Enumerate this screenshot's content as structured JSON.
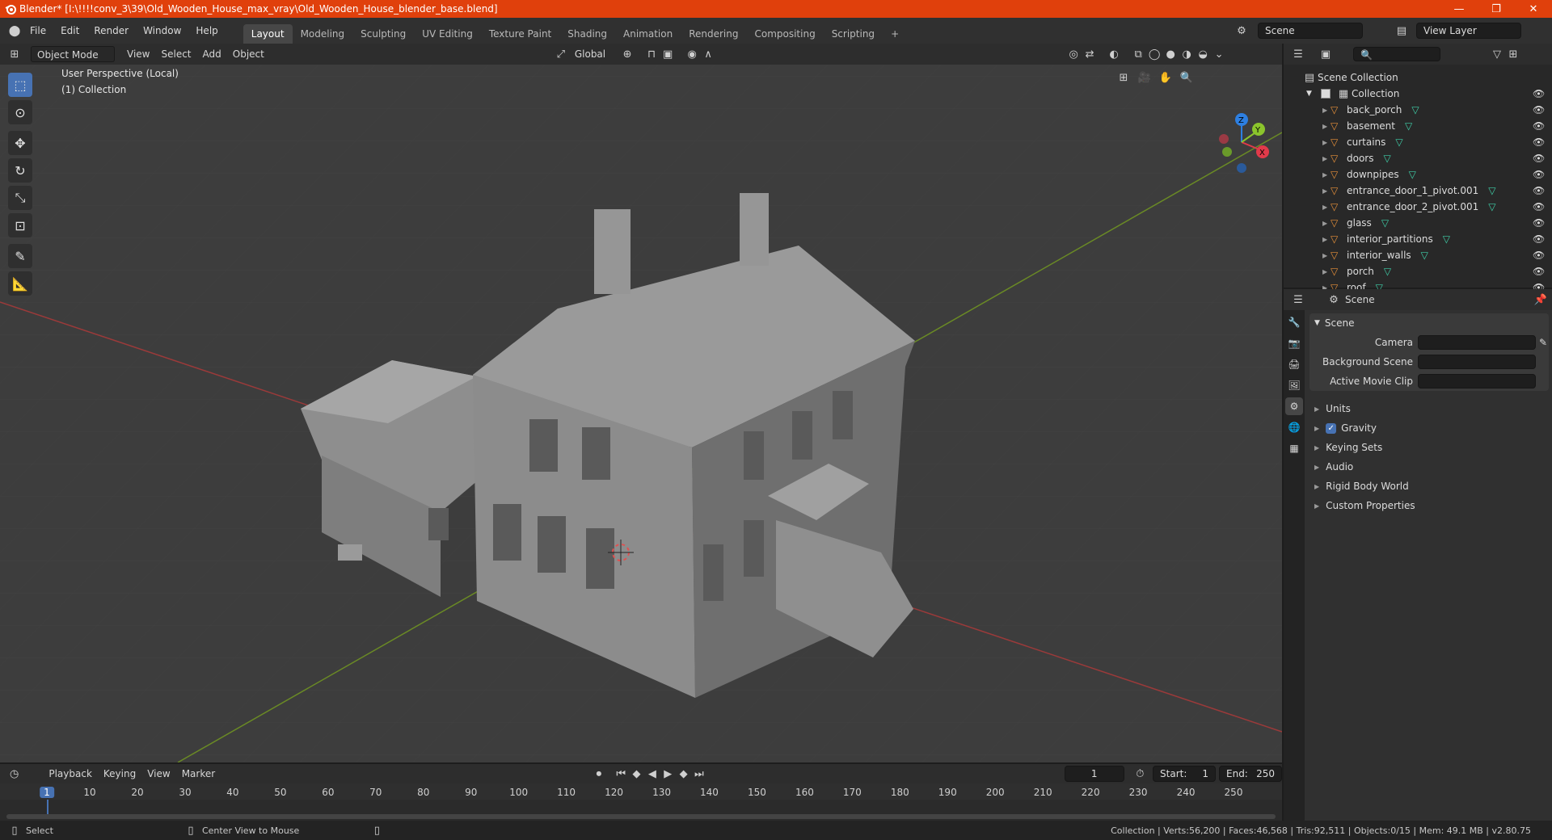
{
  "window": {
    "title": "Blender* [I:\\!!!!conv_3\\39\\Old_Wooden_House_max_vray\\Old_Wooden_House_blender_base.blend]",
    "minimize": "—",
    "maximize": "❐",
    "close": "✕"
  },
  "menu": {
    "items": [
      "File",
      "Edit",
      "Render",
      "Window",
      "Help"
    ]
  },
  "workspaces": {
    "tabs": [
      "Layout",
      "Modeling",
      "Sculpting",
      "UV Editing",
      "Texture Paint",
      "Shading",
      "Animation",
      "Rendering",
      "Compositing",
      "Scripting"
    ],
    "active": "Layout",
    "add": "+"
  },
  "scene_selector": {
    "value": "Scene"
  },
  "view_layer": {
    "value": "View Layer"
  },
  "viewport": {
    "mode": "Object Mode",
    "menus": [
      "View",
      "Select",
      "Add",
      "Object"
    ],
    "transform_orientation": "Global",
    "overlay_line1": "User Perspective (Local)",
    "overlay_line2": "(1) Collection",
    "gizmo": {
      "x": "X",
      "y": "Y",
      "z": "Z"
    },
    "colors": {
      "x_axis": "#9b3a3a",
      "y_axis": "#6a8a25",
      "gizmo_x": "#e13a4a",
      "gizmo_y": "#8bc42c",
      "gizmo_z": "#2d7fe1"
    }
  },
  "outliner": {
    "search_placeholder": "",
    "root": "Scene Collection",
    "collection": "Collection",
    "objects": [
      "back_porch",
      "basement",
      "curtains",
      "doors",
      "downpipes",
      "entrance_door_1_pivot.001",
      "entrance_door_2_pivot.001",
      "glass",
      "interior_partitions",
      "interior_walls",
      "porch",
      "roof"
    ]
  },
  "properties": {
    "header": "Scene",
    "section": "Scene",
    "camera_label": "Camera",
    "background_scene_label": "Background Scene",
    "active_movie_clip_label": "Active Movie Clip",
    "panels": [
      "Units",
      "Gravity",
      "Keying Sets",
      "Audio",
      "Rigid Body World",
      "Custom Properties"
    ],
    "gravity_checked": true
  },
  "timeline": {
    "menus": [
      "Playback",
      "Keying",
      "View",
      "Marker"
    ],
    "current_frame": "1",
    "start_label": "Start:",
    "start": "1",
    "end_label": "End:",
    "end": "250",
    "ticks": [
      "1",
      "10",
      "20",
      "30",
      "40",
      "50",
      "60",
      "70",
      "80",
      "90",
      "100",
      "110",
      "120",
      "130",
      "140",
      "150",
      "160",
      "170",
      "180",
      "190",
      "200",
      "210",
      "220",
      "230",
      "240",
      "250"
    ]
  },
  "status": {
    "left1": "Select",
    "left2": "Center View to Mouse",
    "right": "Collection | Verts:56,200 | Faces:46,568 | Tris:92,511 | Objects:0/15 | Mem: 49.1 MB | v2.80.75"
  }
}
